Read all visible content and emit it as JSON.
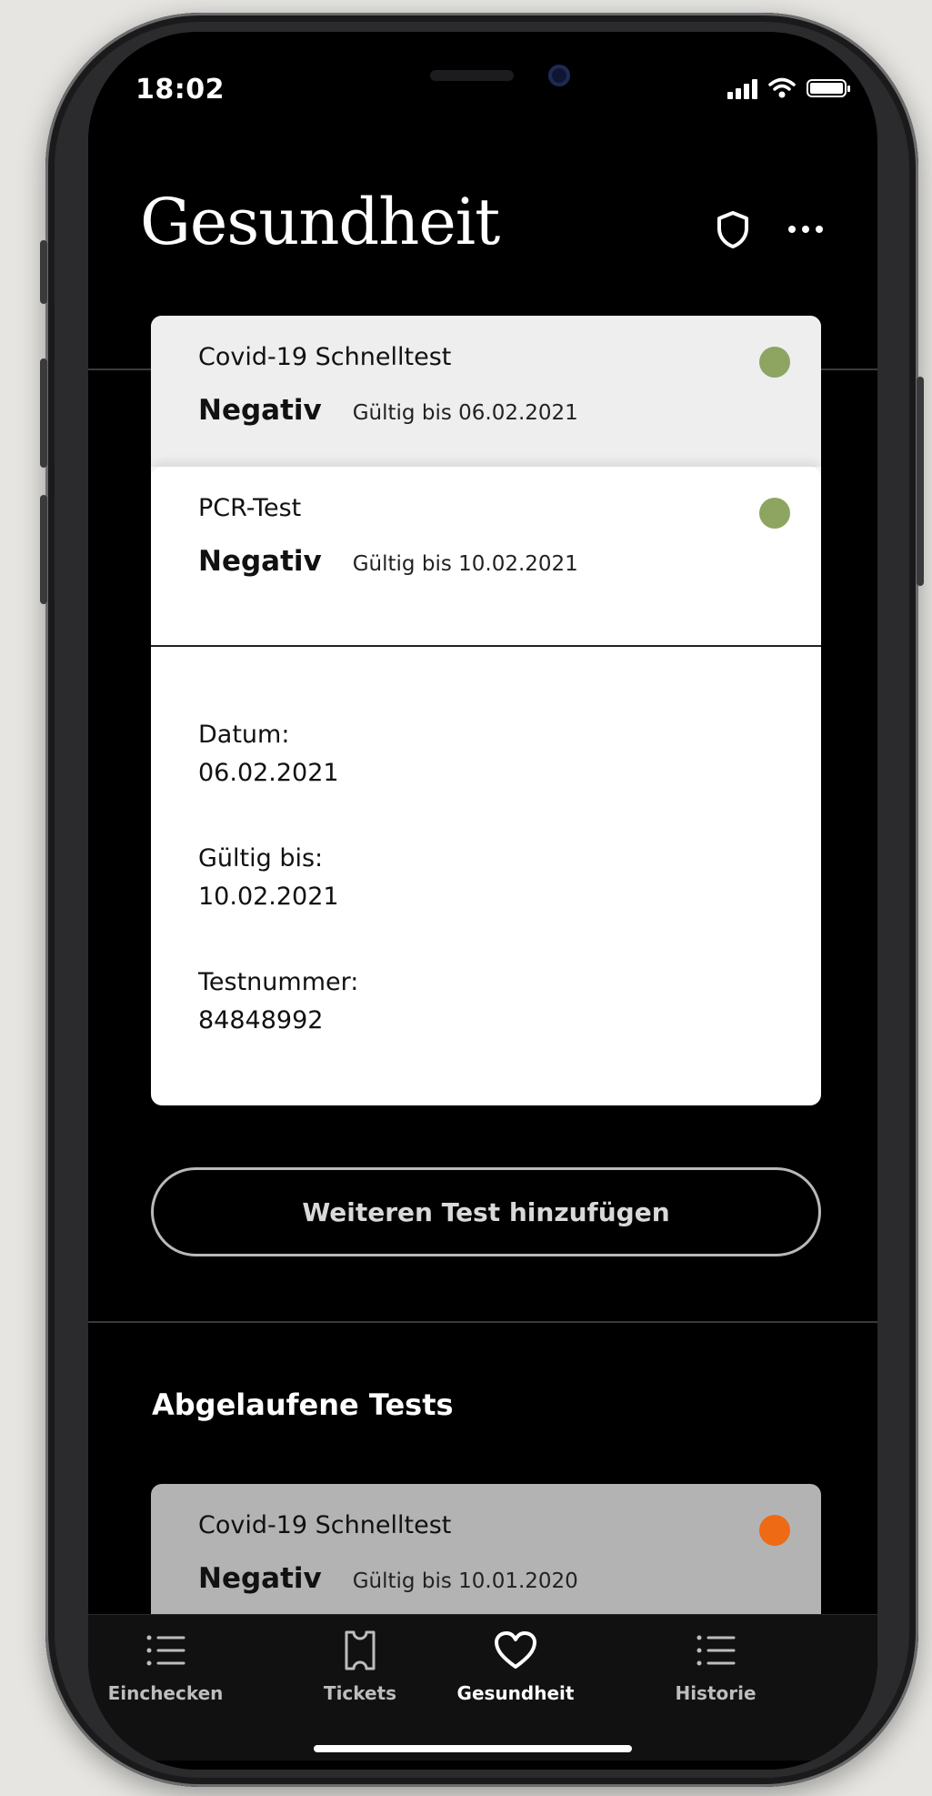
{
  "status_bar": {
    "time": "18:02"
  },
  "header": {
    "title": "Gesundheit",
    "shield_icon": "shield-icon",
    "more_icon": "more-icon"
  },
  "active_tests": [
    {
      "name": "Covid-19 Schnelltest",
      "result": "Negativ",
      "valid_until": "Gültig bis 06.02.2021",
      "status_color": "#8da561"
    },
    {
      "name": "PCR-Test",
      "result": "Negativ",
      "valid_until": "Gültig bis 10.02.2021",
      "status_color": "#8da561"
    }
  ],
  "details": [
    {
      "label": "Datum:",
      "value": "06.02.2021"
    },
    {
      "label": "Gültig bis:",
      "value": "10.02.2021"
    },
    {
      "label": "Testnummer:",
      "value": "84848992"
    }
  ],
  "add_button_label": "Weiteren Test hinzufügen",
  "expired": {
    "title": "Abgelaufene Tests",
    "tests": [
      {
        "name": "Covid-19 Schnelltest",
        "result": "Negativ",
        "valid_until": "Gültig bis 10.01.2020",
        "status_color": "#ee6a14"
      }
    ]
  },
  "tab_bar": {
    "tabs": [
      {
        "label": "Einchecken",
        "icon": "list-icon"
      },
      {
        "label": "Tickets",
        "icon": "ticket-icon"
      },
      {
        "label": "Gesundheit",
        "icon": "heart-icon",
        "active": true
      },
      {
        "label": "Historie",
        "icon": "list-icon"
      }
    ]
  }
}
